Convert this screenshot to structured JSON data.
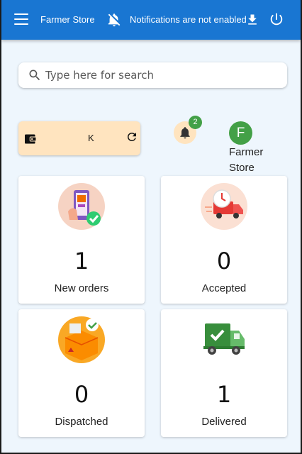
{
  "appbar": {
    "title": "Farmer Store",
    "notification_status": "Notifications are not enabled",
    "menu_icon": "menu-icon",
    "bell_off_icon": "notifications-off-icon",
    "download_icon": "download-icon",
    "power_icon": "power-icon"
  },
  "search": {
    "placeholder": "Type here for search",
    "value": ""
  },
  "wallet": {
    "value": "K",
    "icon": "wallet-icon",
    "refresh_icon": "refresh-icon"
  },
  "notifications": {
    "count": "2",
    "icon": "bell-icon"
  },
  "profile": {
    "initial": "F",
    "name": "Farmer Store"
  },
  "stats": [
    {
      "label": "New orders",
      "value": "1",
      "icon": "phone-checkout-icon"
    },
    {
      "label": "Accepted",
      "value": "0",
      "icon": "delivery-truck-clock-icon"
    },
    {
      "label": "Dispatched",
      "value": "0",
      "icon": "package-box-icon"
    },
    {
      "label": "Delivered",
      "value": "1",
      "icon": "truck-check-icon"
    }
  ],
  "colors": {
    "primary": "#1976d2",
    "accent_green": "#43a047",
    "card_peach": "#ffe4bf",
    "background": "#eef6fd"
  }
}
